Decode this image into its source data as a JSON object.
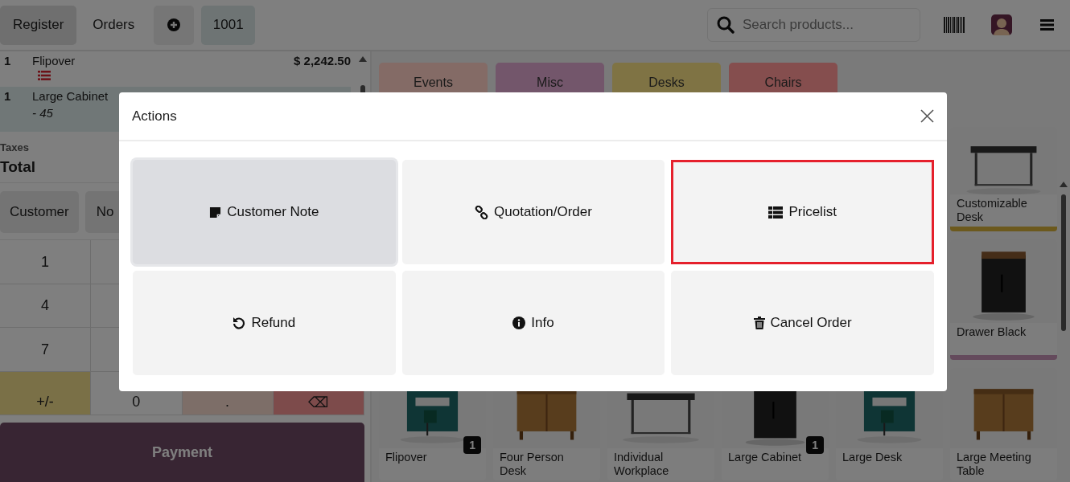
{
  "header": {
    "tabs": [
      {
        "label": "Register",
        "selected": true
      },
      {
        "label": "Orders",
        "selected": false
      }
    ],
    "order_number": "1001",
    "search": {
      "placeholder": "Search products..."
    }
  },
  "order_lines": [
    {
      "qty": "1",
      "name": "Flipover",
      "price": "$ 2,242.50",
      "marker": true,
      "selected": false
    },
    {
      "qty": "1",
      "name": "Large Cabinet",
      "note": "- 45",
      "marker": false,
      "selected": true
    }
  ],
  "summary": {
    "taxes_label": "Taxes",
    "total_label": "Total"
  },
  "action_buttons": [
    {
      "label": "Customer"
    },
    {
      "label": "No"
    }
  ],
  "numpad_rows": [
    [
      {
        "label": "1",
        "kind": "digit"
      }
    ],
    [
      {
        "label": "4",
        "kind": "digit"
      }
    ],
    [
      {
        "label": "7",
        "kind": "digit"
      }
    ],
    [
      {
        "label": "+/-",
        "kind": "sign"
      },
      {
        "label": "0",
        "kind": "digit"
      },
      {
        "label": ".",
        "kind": "decimal"
      },
      {
        "label": "⌫",
        "kind": "backspace"
      }
    ]
  ],
  "payment": "Payment",
  "categories": [
    {
      "label": "Events",
      "color": "#846b66"
    },
    {
      "label": "Misc",
      "color": "#73566b"
    },
    {
      "label": "Desks",
      "color": "#7f7344"
    },
    {
      "label": "Chairs",
      "color": "#854e4e"
    }
  ],
  "side_products": [
    {
      "name": "Customizable Desk",
      "color": "#6c591d"
    },
    {
      "name": "Drawer Black",
      "color": "#644a5c"
    }
  ],
  "bottom_products": [
    {
      "name": "Flipover",
      "quantity": "1"
    },
    {
      "name": "Four Person Desk"
    },
    {
      "name": "Individual Workplace"
    },
    {
      "name": "Large Cabinet",
      "quantity": "1"
    },
    {
      "name": "Large Desk"
    },
    {
      "name": "Large Meeting Table"
    }
  ],
  "dialog": {
    "title": "Actions",
    "buttons": [
      {
        "label": "Customer Note",
        "kind": "note",
        "focused": true,
        "highlighted": false
      },
      {
        "label": "Quotation/Order",
        "kind": "link",
        "focused": false,
        "highlighted": false
      },
      {
        "label": "Pricelist",
        "kind": "list",
        "focused": false,
        "highlighted": true
      },
      {
        "label": "Refund",
        "kind": "undo",
        "focused": false,
        "highlighted": false
      },
      {
        "label": "Info",
        "kind": "info",
        "focused": false,
        "highlighted": false
      },
      {
        "label": "Cancel Order",
        "kind": "trash",
        "focused": false,
        "highlighted": false
      }
    ]
  }
}
